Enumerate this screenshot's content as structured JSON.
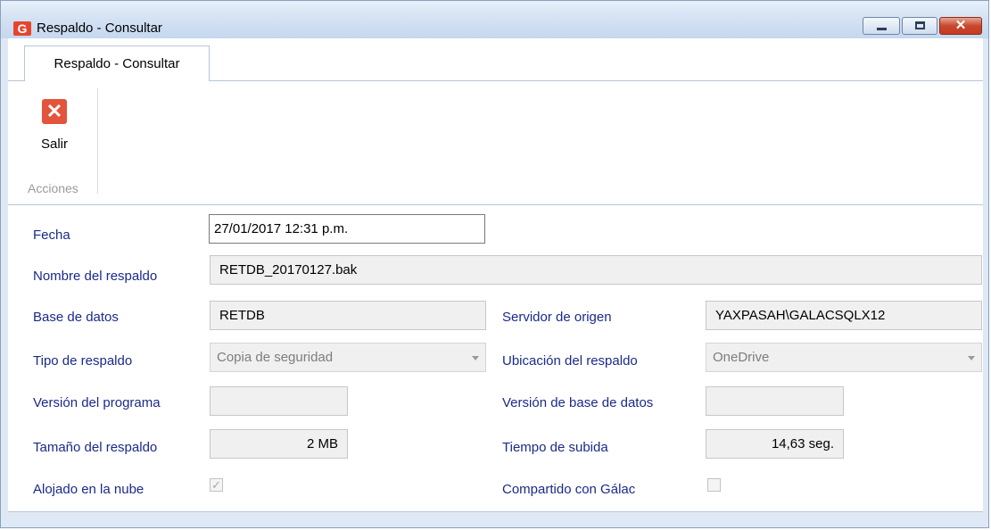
{
  "window": {
    "title": "Respaldo - Consultar",
    "app_icon_glyph": "G",
    "close_glyph": "✕"
  },
  "tabs": [
    {
      "label": "Respaldo - Consultar",
      "active": true
    }
  ],
  "ribbon": {
    "buttons": [
      {
        "label": "Salir",
        "icon": "close-x-icon",
        "icon_glyph": "✕",
        "icon_color": "#e4533b"
      }
    ],
    "group_label": "Acciones"
  },
  "form": {
    "fecha": {
      "label": "Fecha",
      "value": "27/01/2017 12:31 p.m."
    },
    "nombre_respaldo": {
      "label": "Nombre del respaldo",
      "value": "RETDB_20170127.bak"
    },
    "base_datos": {
      "label": "Base de datos",
      "value": "RETDB"
    },
    "servidor_origen": {
      "label": "Servidor de origen",
      "value": "YAXPASAH\\GALACSQLX12"
    },
    "tipo_respaldo": {
      "label": "Tipo de respaldo",
      "value": "Copia de seguridad"
    },
    "ubicacion_respaldo": {
      "label": "Ubicación del respaldo",
      "value": "OneDrive"
    },
    "version_programa": {
      "label": "Versión del programa",
      "value": ""
    },
    "version_bd": {
      "label": "Versión de base de datos",
      "value": ""
    },
    "tamano_respaldo": {
      "label": "Tamaño del respaldo",
      "value": "2 MB"
    },
    "tiempo_subida": {
      "label": "Tiempo de subida",
      "value": "14,63 seg."
    },
    "alojado_nube": {
      "label": "Alojado en la nube",
      "checked": true,
      "check_glyph": "✓"
    },
    "compartido_galac": {
      "label": "Compartido con Gálac",
      "checked": false
    }
  },
  "colors": {
    "label_text": "#1a2a8a",
    "accent_red": "#e4533b",
    "frame_blue": "#dfe9f5"
  }
}
